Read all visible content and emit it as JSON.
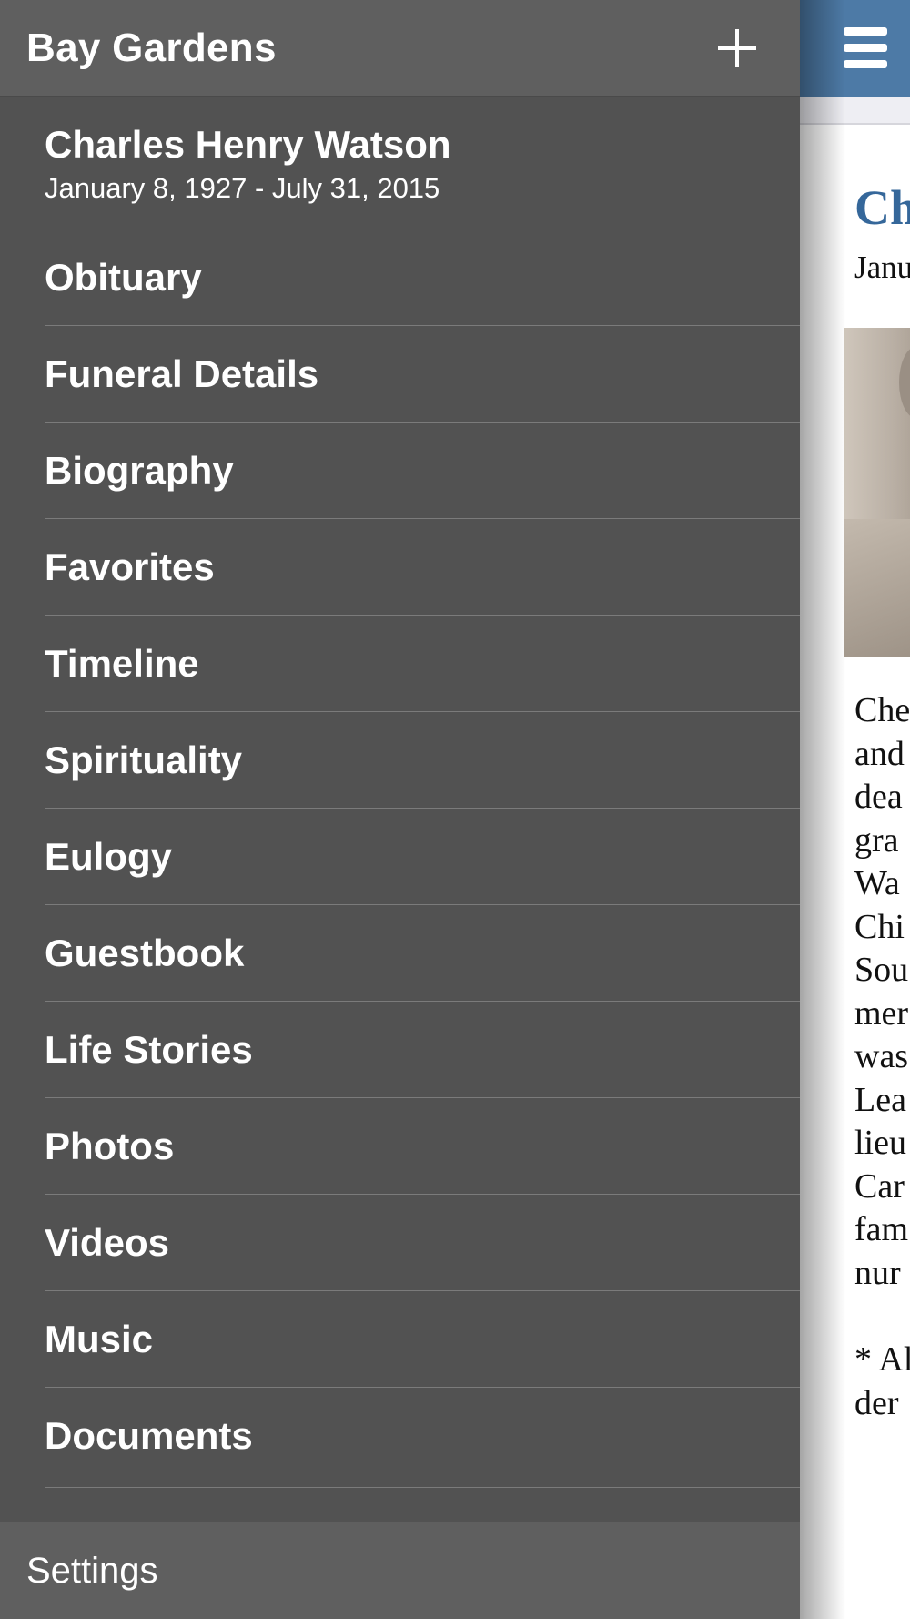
{
  "header": {
    "title": "Bay Gardens",
    "add_icon": "plus-icon"
  },
  "person": {
    "name": "Charles Henry Watson",
    "dates": "January 8, 1927 - July 31, 2015"
  },
  "menu": {
    "items": [
      {
        "label": "Obituary"
      },
      {
        "label": "Funeral Details"
      },
      {
        "label": "Biography"
      },
      {
        "label": "Favorites"
      },
      {
        "label": "Timeline"
      },
      {
        "label": "Spirituality"
      },
      {
        "label": "Eulogy"
      },
      {
        "label": "Guestbook"
      },
      {
        "label": "Life Stories"
      },
      {
        "label": "Photos"
      },
      {
        "label": "Videos"
      },
      {
        "label": "Music"
      },
      {
        "label": "Documents"
      }
    ]
  },
  "footer": {
    "settings_label": "Settings"
  },
  "content": {
    "menu_icon": "hamburger-menu-icon",
    "title_fragment": "Ch",
    "dates_fragment": "Janu",
    "body_lines": [
      "Che",
      "and",
      "dea",
      "gra",
      "Wa",
      "Chi",
      "Sou",
      "mer",
      "was",
      "Lea",
      "lieu",
      "Car",
      "fam",
      "nur"
    ],
    "note_lines": [
      "* Al",
      "der"
    ]
  },
  "colors": {
    "drawer_bg": "#525252",
    "drawer_header_bg": "#5f5f5f",
    "topbar_blue": "#4d7aa6",
    "title_blue": "#35679a"
  }
}
